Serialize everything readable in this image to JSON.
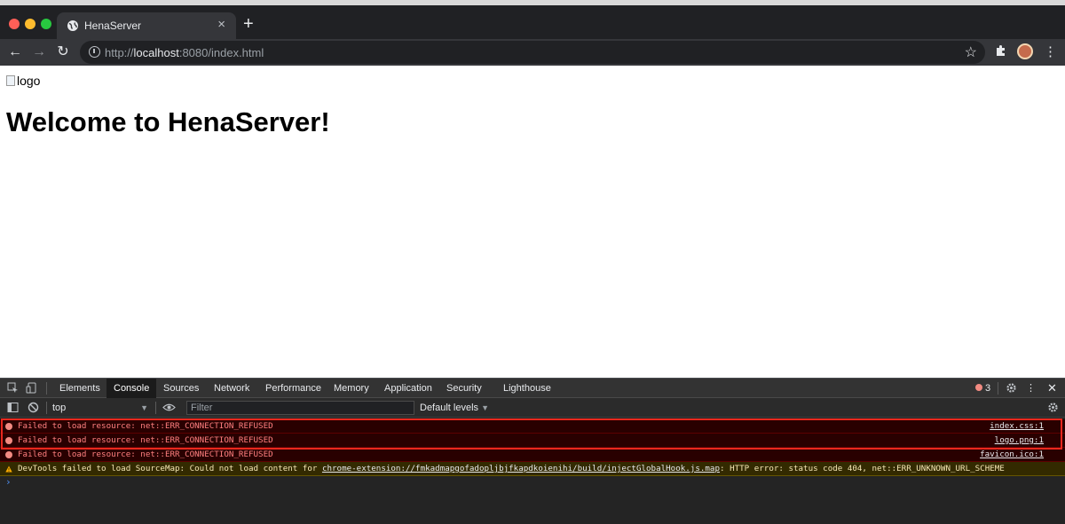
{
  "browser": {
    "tab_title": "HenaServer",
    "url": {
      "scheme": "http://",
      "host": "localhost",
      "rest": ":8080/index.html"
    }
  },
  "page": {
    "logo_alt": "logo",
    "heading": "Welcome to HenaServer!"
  },
  "devtools": {
    "tabs": [
      "Elements",
      "Console",
      "Sources",
      "Network",
      "Performance",
      "Memory",
      "Application",
      "Security",
      "Lighthouse"
    ],
    "active_tab": "Console",
    "error_count": "3",
    "context": "top",
    "filter_placeholder": "Filter",
    "levels_label": "Default levels",
    "messages": [
      {
        "level": "error",
        "text": "Failed to load resource: net::ERR_CONNECTION_REFUSED",
        "source": "index.css:1"
      },
      {
        "level": "error",
        "text": "Failed to load resource: net::ERR_CONNECTION_REFUSED",
        "source": "logo.png:1"
      },
      {
        "level": "error",
        "text": "Failed to load resource: net::ERR_CONNECTION_REFUSED",
        "source": "favicon.ico:1"
      },
      {
        "level": "warning",
        "text_before": "DevTools failed to load SourceMap: Could not load content for ",
        "link": "chrome-extension://fmkadmapgofadopljbjfkapdkoienihi/build/injectGlobalHook.js.map",
        "text_after": ": HTTP error: status code 404, net::ERR_UNKNOWN_URL_SCHEME"
      }
    ]
  },
  "colors": {
    "error_bg": "#290000",
    "error_text": "#ff8080",
    "warning_bg": "#332a00",
    "highlight": "#e8281e"
  }
}
